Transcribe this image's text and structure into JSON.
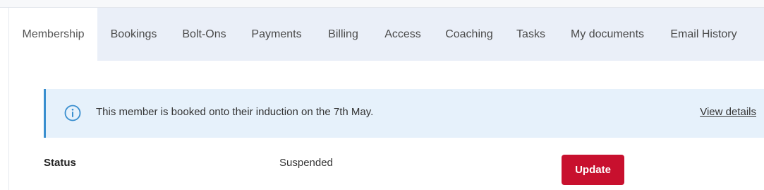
{
  "tabs": [
    {
      "label": "Membership",
      "active": true
    },
    {
      "label": "Bookings",
      "active": false
    },
    {
      "label": "Bolt-Ons",
      "active": false
    },
    {
      "label": "Payments",
      "active": false
    },
    {
      "label": "Billing",
      "active": false
    },
    {
      "label": "Access",
      "active": false
    },
    {
      "label": "Coaching",
      "active": false
    },
    {
      "label": "Tasks",
      "active": false
    },
    {
      "label": "My documents",
      "active": false
    },
    {
      "label": "Email History",
      "active": false
    }
  ],
  "banner": {
    "icon": "info-icon",
    "message": "This member is booked onto their induction on the 7th May.",
    "link_label": "View details"
  },
  "status": {
    "label": "Status",
    "value": "Suspended",
    "action_label": "Update"
  },
  "colors": {
    "tabbar_bg": "#eaeff8",
    "banner_bg": "#e6f1fb",
    "banner_accent": "#3a8fcf",
    "button": "#c8102e"
  }
}
